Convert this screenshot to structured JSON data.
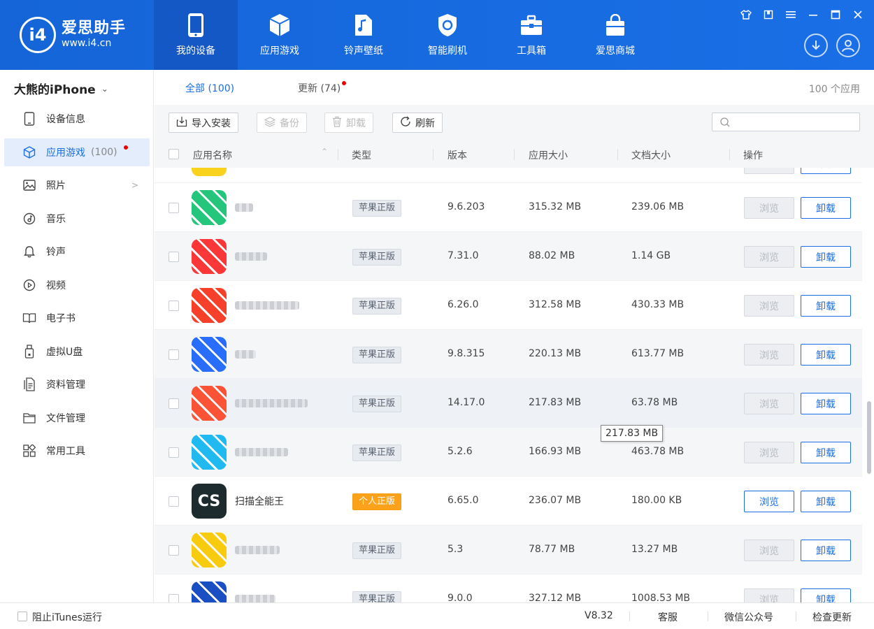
{
  "logo": {
    "title": "爱思助手",
    "url": "www.i4.cn",
    "mark": "i4"
  },
  "nav": [
    {
      "label": "我的设备",
      "icon": "phone-icon"
    },
    {
      "label": "应用游戏",
      "icon": "cube-icon"
    },
    {
      "label": "铃声壁纸",
      "icon": "music-folder-icon"
    },
    {
      "label": "智能刷机",
      "icon": "shield-refresh-icon"
    },
    {
      "label": "工具箱",
      "icon": "toolbox-icon"
    },
    {
      "label": "爱思商城",
      "icon": "shopping-bag-icon"
    }
  ],
  "device": {
    "name": "大熊的iPhone"
  },
  "sidebar": {
    "items": [
      {
        "label": "设备信息",
        "icon": "device-info-icon"
      },
      {
        "label": "应用游戏",
        "icon": "app-cube-icon",
        "count": "(100)"
      },
      {
        "label": "照片",
        "icon": "photo-icon"
      },
      {
        "label": "音乐",
        "icon": "music-icon"
      },
      {
        "label": "铃声",
        "icon": "bell-icon"
      },
      {
        "label": "视频",
        "icon": "video-icon"
      },
      {
        "label": "电子书",
        "icon": "ebook-icon"
      },
      {
        "label": "虚拟U盘",
        "icon": "usb-icon"
      },
      {
        "label": "资料管理",
        "icon": "documents-icon"
      },
      {
        "label": "文件管理",
        "icon": "folder-icon"
      },
      {
        "label": "常用工具",
        "icon": "tools-grid-icon"
      }
    ]
  },
  "tabs": {
    "all": "全部 (100)",
    "updates": "更新 (74)"
  },
  "total_label": "100 个应用",
  "toolbar": {
    "import": "导入安装",
    "backup": "备份",
    "uninstall": "卸载",
    "refresh": "刷新"
  },
  "table": {
    "headers": {
      "name": "应用名称",
      "type": "类型",
      "version": "版本",
      "app_size": "应用大小",
      "doc_size": "文档大小",
      "actions": "操作"
    },
    "browse_label": "浏览",
    "uninstall_label": "卸载",
    "rows": [
      {
        "name": "",
        "type": "苹果正版",
        "version": "9.6.203",
        "app_size": "315.32 MB",
        "doc_size": "239.06 MB",
        "icon_color": "#2ec27e",
        "browse_enabled": false
      },
      {
        "name": "",
        "type": "苹果正版",
        "version": "7.31.0",
        "app_size": "88.02 MB",
        "doc_size": "1.14 GB",
        "icon_color": "#ee3b3b",
        "browse_enabled": false
      },
      {
        "name": "",
        "type": "苹果正版",
        "version": "6.26.0",
        "app_size": "312.58 MB",
        "doc_size": "430.33 MB",
        "icon_color": "#e9432f",
        "browse_enabled": false
      },
      {
        "name": "",
        "type": "苹果正版",
        "version": "9.8.315",
        "app_size": "220.13 MB",
        "doc_size": "613.77 MB",
        "icon_color": "#2f6df0",
        "browse_enabled": false
      },
      {
        "name": "",
        "type": "苹果正版",
        "version": "14.17.0",
        "app_size": "217.83 MB",
        "doc_size": "63.78 MB",
        "icon_color": "#f0563c",
        "browse_enabled": false
      },
      {
        "name": "",
        "type": "苹果正版",
        "version": "5.2.6",
        "app_size": "166.93 MB",
        "doc_size": "463.78 MB",
        "icon_color": "#2bb7e8",
        "browse_enabled": false
      },
      {
        "name": "扫描全能王",
        "type": "个人正版",
        "version": "6.65.0",
        "app_size": "236.07 MB",
        "doc_size": "180.00 KB",
        "icon_color": "#1d2b2e",
        "icon_text": "CS",
        "browse_enabled": true
      },
      {
        "name": "",
        "type": "苹果正版",
        "version": "5.3",
        "app_size": "78.77 MB",
        "doc_size": "13.27 MB",
        "icon_color": "#f4cc1f",
        "browse_enabled": false
      },
      {
        "name": "",
        "type": "苹果正版",
        "version": "9.0.0",
        "app_size": "327.12 MB",
        "doc_size": "1008.53 MB",
        "icon_color": "#1e4fb8",
        "browse_enabled": false
      }
    ]
  },
  "tooltip": "217.83 MB",
  "footer": {
    "itunes": "阻止iTunes运行",
    "version": "V8.32",
    "service": "客服",
    "wechat": "微信公众号",
    "update": "检查更新"
  },
  "colors": {
    "accent": "#1a6fe6",
    "header": "#1565d8",
    "badge_dot": "#e00000",
    "personal_tag": "#fba21a"
  }
}
